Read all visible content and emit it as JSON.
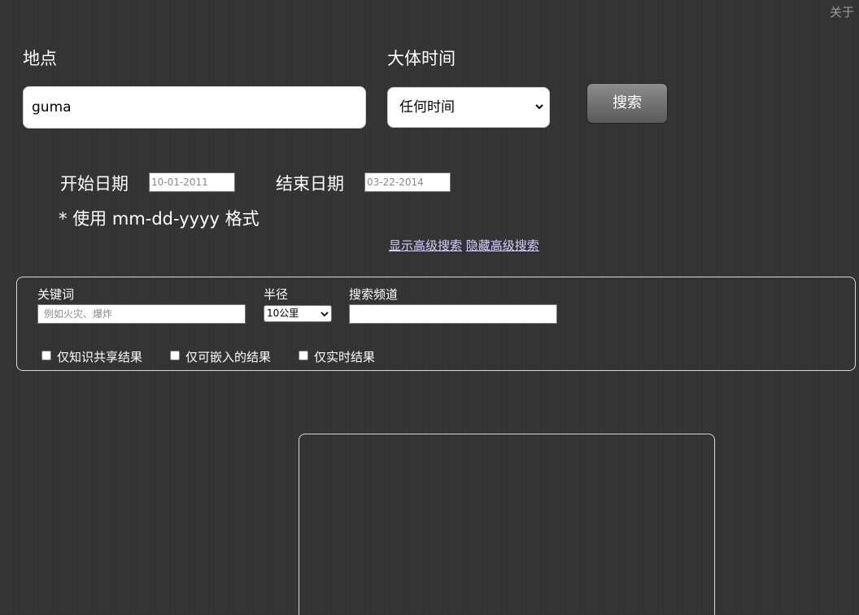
{
  "header": {
    "about_label": "关于"
  },
  "search": {
    "location_label": "地点",
    "location_value": "guma",
    "time_label": "大体时间",
    "time_selected": "任何时间",
    "submit_label": "搜索"
  },
  "dates": {
    "start_label": "开始日期",
    "start_placeholder": "10-01-2011",
    "end_label": "结束日期",
    "end_placeholder": "03-22-2014",
    "format_note": "* 使用 mm-dd-yyyy 格式"
  },
  "advanced_toggle": {
    "show_label": "显示高级搜索",
    "hide_label": "隐藏高级搜索"
  },
  "advanced": {
    "keyword_label": "关键词",
    "keyword_placeholder": "例如火灾、爆炸",
    "radius_label": "半径",
    "radius_selected": "10公里",
    "channel_label": "搜索频道",
    "channel_value": "",
    "checkboxes": [
      {
        "label": "仅知识共享结果",
        "checked": false
      },
      {
        "label": "仅可嵌入的结果",
        "checked": false
      },
      {
        "label": "仅实时结果",
        "checked": false
      }
    ]
  }
}
